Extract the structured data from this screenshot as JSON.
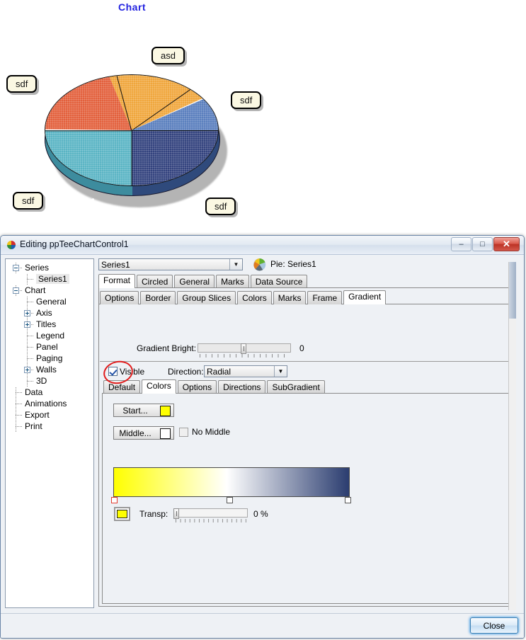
{
  "chart_data": {
    "type": "pie",
    "title": "Chart",
    "title_color": "#2222e0",
    "legend": "none",
    "grid": false,
    "labels": [
      "asd",
      "sdf",
      "sdf",
      "sdf",
      "sdf"
    ],
    "values": [
      19.4,
      15.3,
      25.0,
      25.0,
      15.3
    ],
    "slices": [
      {
        "label": "asd",
        "value": 19.4,
        "color": "#f0a63c",
        "start_deg": 35,
        "end_deg": 105
      },
      {
        "label": "sdf",
        "value": 15.3,
        "color": "#e3603c",
        "start_deg": 105,
        "end_deg": 180
      },
      {
        "label": "sdf",
        "value": 25.0,
        "color": "#5ab4c4",
        "start_deg": 180,
        "end_deg": 270
      },
      {
        "label": "sdf",
        "value": 25.0,
        "color": "#33437e",
        "start_deg": 270,
        "end_deg": 360
      },
      {
        "label": "sdf",
        "value": 15.3,
        "color": "#5a7fbe",
        "start_deg": 0,
        "end_deg": 35
      }
    ]
  },
  "callouts": [
    {
      "text": "asd"
    },
    {
      "text": "sdf"
    },
    {
      "text": "sdf"
    },
    {
      "text": "sdf"
    },
    {
      "text": "sdf"
    }
  ],
  "window": {
    "title": "Editing ppTeeChartControl1",
    "minimize_label": "–",
    "maximize_label": "□",
    "close_label": "✕"
  },
  "tree": {
    "items": [
      {
        "label": "Series",
        "indent": 0,
        "toggle": "minus",
        "selected": false
      },
      {
        "label": "Series1",
        "indent": 1,
        "toggle": "none",
        "selected": true
      },
      {
        "label": "Chart",
        "indent": 0,
        "toggle": "minus",
        "selected": false
      },
      {
        "label": "General",
        "indent": 1,
        "toggle": "none",
        "selected": false
      },
      {
        "label": "Axis",
        "indent": 1,
        "toggle": "plus",
        "selected": false
      },
      {
        "label": "Titles",
        "indent": 1,
        "toggle": "plus",
        "selected": false
      },
      {
        "label": "Legend",
        "indent": 1,
        "toggle": "none",
        "selected": false
      },
      {
        "label": "Panel",
        "indent": 1,
        "toggle": "none",
        "selected": false
      },
      {
        "label": "Paging",
        "indent": 1,
        "toggle": "none",
        "selected": false
      },
      {
        "label": "Walls",
        "indent": 1,
        "toggle": "plus",
        "selected": false
      },
      {
        "label": "3D",
        "indent": 1,
        "toggle": "none",
        "selected": false
      },
      {
        "label": "Data",
        "indent": 0,
        "toggle": "none",
        "selected": false
      },
      {
        "label": "Animations",
        "indent": 0,
        "toggle": "none",
        "selected": false
      },
      {
        "label": "Export",
        "indent": 0,
        "toggle": "none",
        "selected": false
      },
      {
        "label": "Print",
        "indent": 0,
        "toggle": "none",
        "selected": false
      }
    ]
  },
  "series_bar": {
    "combo_value": "Series1",
    "arrow": "▼",
    "caption": "Pie: Series1"
  },
  "tabs_main": [
    {
      "label": "Format",
      "active": true
    },
    {
      "label": "Circled",
      "active": false
    },
    {
      "label": "General",
      "active": false
    },
    {
      "label": "Marks",
      "active": false
    },
    {
      "label": "Data Source",
      "active": false
    }
  ],
  "tabs_sub": [
    {
      "label": "Options",
      "active": false
    },
    {
      "label": "Border",
      "active": false
    },
    {
      "label": "Group Slices",
      "active": false
    },
    {
      "label": "Colors",
      "active": false
    },
    {
      "label": "Marks",
      "active": false
    },
    {
      "label": "Frame",
      "active": false
    },
    {
      "label": "Gradient",
      "active": true
    }
  ],
  "gradient": {
    "bright_label": "Gradient Bright:",
    "bright_value": "0",
    "visible_label": "Visible",
    "visible_checked": true,
    "direction_label": "Direction:",
    "direction_value": "Radial",
    "direction_arrow": "▼"
  },
  "tabs_gradient": [
    {
      "label": "Default",
      "active": false
    },
    {
      "label": "Colors",
      "active": true
    },
    {
      "label": "Options",
      "active": false
    },
    {
      "label": "Directions",
      "active": false
    },
    {
      "label": "SubGradient",
      "active": false
    }
  ],
  "colors_tab": {
    "start_label": "Start...",
    "start_color": "#ffff00",
    "middle_label": "Middle...",
    "middle_color": "#ffffff",
    "no_middle_label": "No Middle",
    "no_middle_checked": false,
    "gradient_start": "#ffff00",
    "gradient_mid": "#ffffff",
    "gradient_end": "#2b3d70",
    "transp_label": "Transp:",
    "transp_value": "0 %",
    "swatch_color": "#ffff00"
  },
  "footer": {
    "close_label": "Close"
  }
}
